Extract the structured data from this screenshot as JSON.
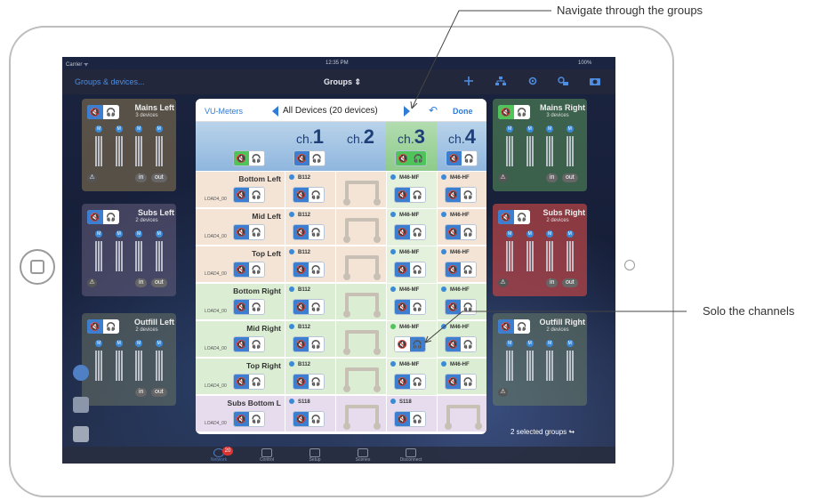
{
  "status": {
    "carrier": "Carrier ᯤ",
    "time": "12:35 PM",
    "battery": "100%"
  },
  "navbar": {
    "left": "Groups & devices...",
    "title": "Groups ⇕"
  },
  "tiles": {
    "mains_left": {
      "name": "Mains Left",
      "sub": "3 devices"
    },
    "subs_left": {
      "name": "Subs Left",
      "sub": "2 devices"
    },
    "outfill_left": {
      "name": "Outfill Left",
      "sub": "2 devices"
    },
    "mains_right": {
      "name": "Mains Right",
      "sub": "3 devices"
    },
    "subs_right": {
      "name": "Subs Right",
      "sub": "2 devices"
    },
    "outfill_right": {
      "name": "Outfill Right",
      "sub": "2 devices"
    },
    "meter_letter": "M",
    "in_label": "in",
    "out_label": "out"
  },
  "panel": {
    "vu": "VU-Meters",
    "title": "All Devices (20 devices)",
    "undo": "↶",
    "done": "Done",
    "channels": [
      {
        "prefix": "ch.",
        "num": "1"
      },
      {
        "prefix": "ch.",
        "num": "2"
      },
      {
        "prefix": "ch.",
        "num": "3"
      },
      {
        "prefix": "ch.",
        "num": "4"
      }
    ],
    "rows": [
      {
        "name": "Bottom Left",
        "load": "LOAD4_00",
        "c1": "B112",
        "c3": "M46-MF",
        "c4": "M46-HF"
      },
      {
        "name": "Mid Left",
        "load": "LOAD4_00",
        "c1": "B112",
        "c3": "M46-MF",
        "c4": "M46-HF"
      },
      {
        "name": "Top Left",
        "load": "LOAD4_00",
        "c1": "B112",
        "c3": "M46-MF",
        "c4": "M46-HF"
      },
      {
        "name": "Bottom Right",
        "load": "LOAD4_00",
        "c1": "B112",
        "c3": "M46-MF",
        "c4": "M46-HF"
      },
      {
        "name": "Mid Right",
        "load": "LOAD4_00",
        "c1": "B112",
        "c3": "M46-MF",
        "c4": "M46-HF"
      },
      {
        "name": "Top Right",
        "load": "LOAD4_00",
        "c1": "B112",
        "c3": "M46-MF",
        "c4": "M46-HF"
      },
      {
        "name": "Subs Bottom L",
        "load": "LOAD4_00",
        "c1": "S118",
        "c3": "S118",
        "c4": ""
      }
    ]
  },
  "selected_groups": "2 selected groups ↬",
  "bottom_tabs": [
    {
      "label": "Network",
      "badge": "20"
    },
    {
      "label": "Control"
    },
    {
      "label": "Setup"
    },
    {
      "label": "Scenes"
    },
    {
      "label": "Disconnect"
    }
  ],
  "callouts": {
    "navigate": "Navigate through the groups",
    "solo": "Solo the channels"
  },
  "colors": {
    "accent": "#2f7bd6",
    "solo_green": "#4ec45b",
    "peach": "#f3e4d6",
    "light_green": "#dbeed3",
    "lavender": "#e7dcee"
  }
}
